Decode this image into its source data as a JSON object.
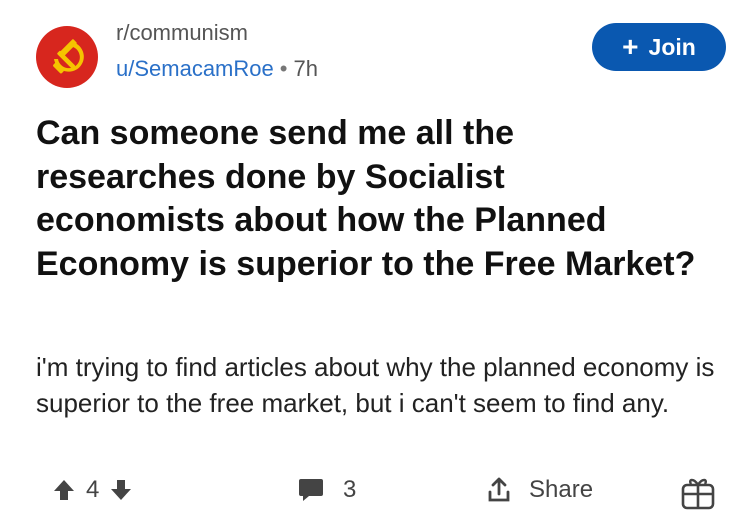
{
  "post": {
    "subreddit": "r/communism",
    "author": "u/SemacamRoe",
    "separator": "•",
    "age": "7h",
    "join_label": "Join",
    "title": "Can someone send me all the researches done by Socialist economists about how the Planned Economy is superior to the Free Market?",
    "body": "i'm trying to find articles about why the planned economy is superior to the free market, but i can't seem to find any."
  },
  "actions": {
    "vote_count": "4",
    "comment_count": "3",
    "share_label": "Share"
  },
  "icons": {
    "avatar": "hammer-sickle-icon",
    "join": "plus-icon",
    "upvote": "arrow-up-icon",
    "downvote": "arrow-down-icon",
    "comments": "comment-bubble-icon",
    "share": "share-icon",
    "award": "gift-icon"
  },
  "colors": {
    "join_button": "#0a58b0",
    "username": "#2a70c8",
    "avatar_bg": "#d7261e",
    "avatar_symbol": "#f5c400"
  }
}
